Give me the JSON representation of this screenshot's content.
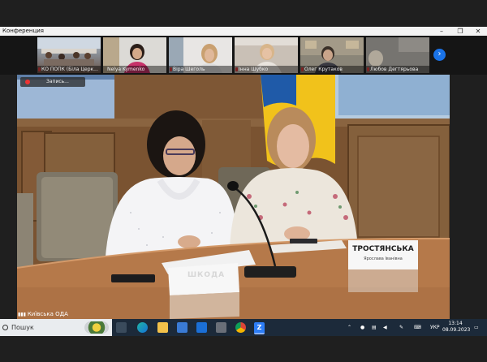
{
  "window": {
    "title": "Конференция",
    "controls": {
      "minimize": "–",
      "maximize": "❐",
      "close": "✕"
    }
  },
  "participants": [
    {
      "name": "КО ПОПК (Біла Церк...",
      "muted": true
    },
    {
      "name": "Nelya Kymenko",
      "muted": false
    },
    {
      "name": "Віра Шеголь",
      "muted": true
    },
    {
      "name": "Інна Шубко",
      "muted": true
    },
    {
      "name": "Олег Крутаков",
      "muted": true
    },
    {
      "name": "Любов Дегтярьова",
      "muted": true
    }
  ],
  "next_button": "›",
  "recording": {
    "label": "Запись..."
  },
  "main_video": {
    "speaker_label": "Київська ОДА",
    "nameplate_right": {
      "name": "ТРОСТЯНСЬКА",
      "subtitle": "Ярослава Іванівна"
    },
    "nameplate_left": {
      "name": "ШКОДА"
    }
  },
  "taskbar": {
    "search_label": "Пошук",
    "language": "УКР",
    "time": "13:14",
    "date": "08.09.2023"
  },
  "colors": {
    "titlebar": "#f3f3f3",
    "accent": "#1a73e8",
    "taskbar": "#1c2a3a",
    "recording_dot": "#e33333",
    "muted_mic": "#e04040"
  }
}
